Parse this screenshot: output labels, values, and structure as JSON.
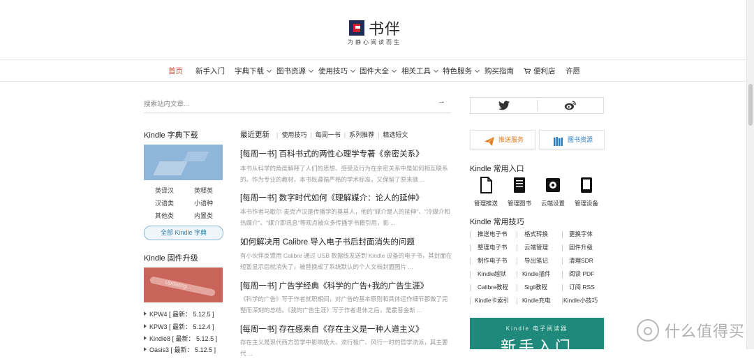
{
  "header": {
    "logo_text": "书伴",
    "tagline": "为静心阅读而生"
  },
  "nav": {
    "items": [
      {
        "label": "首页",
        "active": true,
        "dropdown": false
      },
      {
        "label": "新手入门",
        "dropdown": false
      },
      {
        "label": "字典下载",
        "dropdown": true
      },
      {
        "label": "图书资源",
        "dropdown": true
      },
      {
        "label": "使用技巧",
        "dropdown": true
      },
      {
        "label": "固件大全",
        "dropdown": true
      },
      {
        "label": "相关工具",
        "dropdown": true
      },
      {
        "label": "特色服务",
        "dropdown": true
      },
      {
        "label": "购买指南",
        "dropdown": false
      },
      {
        "label": "便利店",
        "dropdown": false,
        "icon": "cart-icon"
      },
      {
        "label": "许愿",
        "dropdown": false
      }
    ]
  },
  "search": {
    "placeholder": "搜索站内文章..."
  },
  "left": {
    "dict_title": "Kindle 字典下载",
    "dict_items": [
      "英译汉",
      "英释英",
      "汉语类",
      "小语种",
      "其他类",
      "内置类"
    ],
    "dict_button": "全部 Kindle 字典",
    "fw_title": "Kindle 固件升级",
    "fw_image_text": "Updating...",
    "firmware": [
      {
        "model": "KPW4",
        "version": "[ 最新： 5.12.5 ]"
      },
      {
        "model": "KPW3",
        "version": "[ 最新： 5.12.4 ]"
      },
      {
        "model": "Kindle8",
        "version": "[ 最新： 5.12.5 ]"
      },
      {
        "model": "Oasis3",
        "version": "[ 最新： 5.12.5 ]"
      }
    ]
  },
  "main": {
    "tabs": [
      "最近更新",
      "使用技巧",
      "每周一书",
      "系列推荐",
      "精选短文"
    ],
    "articles": [
      {
        "title": "[每周一书] 百科书式的两性心理学专著《亲密关系》",
        "desc": "本书从科学的角度解释了人们的思想、感受及行为在亲密关系中是如何相互联系的。作为专业的教材，本书既遵循严格的学术标准，又保留了原来微 ..."
      },
      {
        "title": "[每周一书] 数字时代如何《理解媒介：论人的延伸》",
        "desc": "本书作者马歇尔·麦克卢汉是传播学的奠基人，他的\"媒介是人的延伸\"、\"冷媒介和热媒介\"、\"媒介即讯息\"等观点被众多传播学书籍引用，影 ..."
      },
      {
        "title": "如何解决用 Calibre 导入电子书后封面消失的问题",
        "desc": "有小伙伴反馈用 Calibre 通过 USB 数据线发送到 Kindle 设备的电子书，其封面在短暂显示后就消失了，被替换成了系统默认的个人文档封面图片 ..."
      },
      {
        "title": "[每周一书] 广告学经典《科学的广告+我的广告生涯》",
        "desc": "《科学的广告》写于作者就职期间，对广告的基本原则和具体运作细节都做了完整而深刻的总结。《我的广告生涯》写于作者退休之后，是霍普金斯 ..."
      },
      {
        "title": "[每周一书] 存在感来自《存在主义是一种人道主义》",
        "desc": "存在主义是现代西方哲学中影响极大、流行极广、风行一时的哲学流派，其主要代 ..."
      }
    ]
  },
  "right": {
    "social": [
      {
        "icon": "twitter-icon"
      },
      {
        "icon": "weibo-icon"
      }
    ],
    "buttons": [
      {
        "label": "推送服务",
        "icon": "paper-plane-icon",
        "color": "#e07b1f"
      },
      {
        "label": "图书资源",
        "icon": "bookshelf-icon",
        "color": "#2b7cc1"
      }
    ],
    "entry_title": "Kindle 常用入口",
    "entries": [
      {
        "label": "管理推送",
        "icon": "document-icon"
      },
      {
        "label": "管理图书",
        "icon": "book-icon"
      },
      {
        "label": "云端设置",
        "icon": "gear-icon"
      },
      {
        "label": "管理设备",
        "icon": "tablet-icon"
      }
    ],
    "tips_title": "Kindle 常用技巧",
    "tips": [
      [
        "推送电子书",
        "格式转换",
        "更换字体"
      ],
      [
        "整理电子书",
        "云端管理",
        "固件升级"
      ],
      [
        "制作电子书",
        "导出笔记",
        "清理SDR"
      ],
      [
        "Kindle越狱",
        "Kindle插件",
        "阅读 PDF"
      ],
      [
        "Calibre教程",
        "Sigil教程",
        "订阅 RSS"
      ],
      [
        "Kindle卡索引",
        "Kindle充电",
        "Kindle小技巧"
      ]
    ],
    "banner": {
      "small": "Kindle 电子阅读器",
      "big": "新手入门",
      "color": "#1f8a7b"
    }
  },
  "watermark": {
    "text": "什么值得买"
  }
}
